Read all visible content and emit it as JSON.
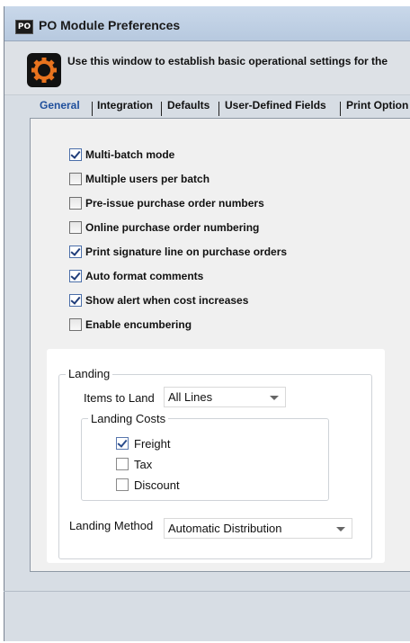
{
  "window": {
    "app_icon_text": "PO",
    "title": "PO Module Preferences",
    "info_text": "Use this window to establish basic operational settings for the"
  },
  "tabs": [
    {
      "label": "General",
      "active": true
    },
    {
      "label": "Integration",
      "active": false
    },
    {
      "label": "Defaults",
      "active": false
    },
    {
      "label": "User-Defined Fields",
      "active": false
    },
    {
      "label": "Print Option",
      "active": false
    }
  ],
  "general": {
    "options": [
      {
        "label": "Multi-batch mode",
        "checked": true
      },
      {
        "label": "Multiple users per batch",
        "checked": false
      },
      {
        "label": "Pre-issue purchase order numbers",
        "checked": false
      },
      {
        "label": "Online purchase order numbering",
        "checked": false
      },
      {
        "label": "Print signature line on purchase orders",
        "checked": true
      },
      {
        "label": "Auto format comments",
        "checked": true
      },
      {
        "label": "Show alert when cost increases",
        "checked": true
      },
      {
        "label": "Enable encumbering",
        "checked": false
      }
    ]
  },
  "landing": {
    "group_label": "Landing",
    "items_to_land_label": "Items to Land",
    "items_to_land_value": "All Lines",
    "costs_label": "Landing Costs",
    "costs": [
      {
        "label": "Freight",
        "checked": true
      },
      {
        "label": "Tax",
        "checked": false
      },
      {
        "label": "Discount",
        "checked": false
      }
    ],
    "method_label": "Landing Method",
    "method_value": "Automatic Distribution"
  },
  "icons": {
    "app": "po-app-icon",
    "info": "gear-icon",
    "dropdown": "chevron-down-icon"
  },
  "colors": {
    "titlebar": "#c1d2e6",
    "active_tab": "#1f4f9c",
    "gear_orange": "#e8731e"
  }
}
